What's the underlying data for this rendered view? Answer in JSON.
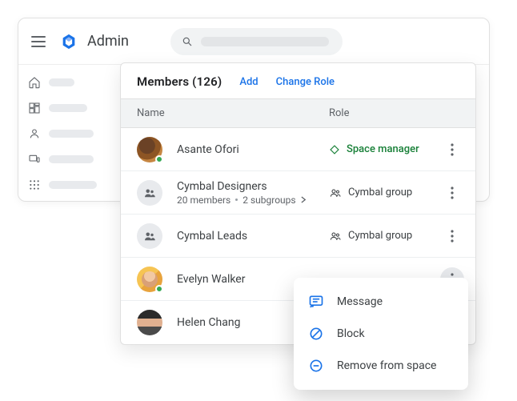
{
  "admin": {
    "title": "Admin"
  },
  "members": {
    "title": "Members (126)",
    "add_label": "Add",
    "change_role_label": "Change Role",
    "col_name": "Name",
    "col_role": "Role",
    "rows": [
      {
        "name": "Asante Ofori",
        "role_text": "Space manager",
        "role_kind": "manager",
        "sub": ""
      },
      {
        "name": "Cymbal Designers",
        "role_text": "Cymbal group",
        "role_kind": "group",
        "sub_members": "20 members",
        "sub_groups": "2 subgroups"
      },
      {
        "name": "Cymbal Leads",
        "role_text": "Cymbal group",
        "role_kind": "group",
        "sub": ""
      },
      {
        "name": "Evelyn Walker",
        "role_text": "",
        "role_kind": "none",
        "sub": ""
      },
      {
        "name": "Helen Chang",
        "role_text": "",
        "role_kind": "none",
        "sub": ""
      }
    ]
  },
  "dropdown": {
    "message": "Message",
    "block": "Block",
    "remove": "Remove from space"
  }
}
